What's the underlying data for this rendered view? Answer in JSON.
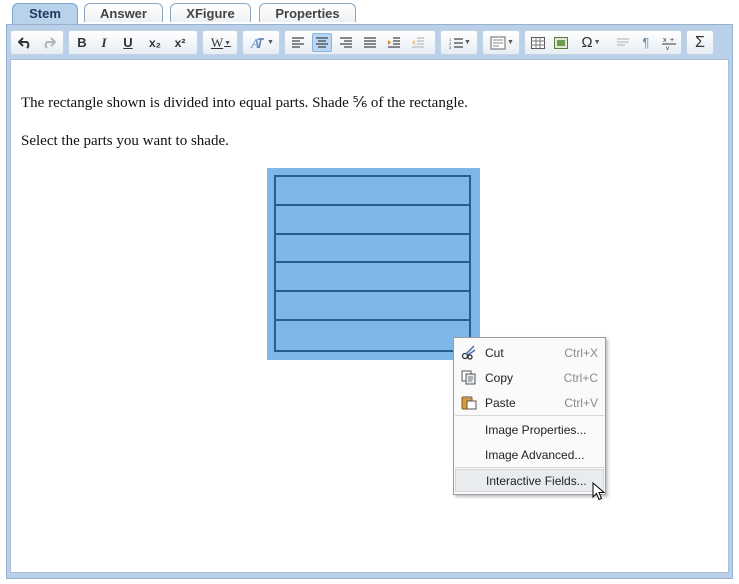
{
  "tabs": [
    {
      "label": "Stem",
      "active": true
    },
    {
      "label": "Answer",
      "active": false
    },
    {
      "label": "XFigure",
      "active": false
    },
    {
      "label": "Properties",
      "active": false
    }
  ],
  "toolbar": {
    "bold": "B",
    "italic": "I",
    "underline": "U",
    "subscript": "x₂",
    "superscript": "x²",
    "word_format": "W",
    "omega": "Ω",
    "sigma": "Σ",
    "pilcrow": "¶"
  },
  "content": {
    "line1": "The rectangle shown is divided into equal parts. Shade ⅚ of the rectangle.",
    "line2": "Select the parts you want to shade."
  },
  "figure": {
    "parts": 6,
    "fill_color": "#7fb7e9",
    "line_color": "#2a5d8f"
  },
  "context_menu": {
    "items": [
      {
        "label": "Cut",
        "shortcut": "Ctrl+X",
        "icon": "scissors-icon"
      },
      {
        "label": "Copy",
        "shortcut": "Ctrl+C",
        "icon": "copy-icon"
      },
      {
        "label": "Paste",
        "shortcut": "Ctrl+V",
        "icon": "paste-icon"
      },
      {
        "label": "Image Properties...",
        "shortcut": ""
      },
      {
        "label": "Image Advanced...",
        "shortcut": ""
      },
      {
        "label": "Interactive Fields...",
        "shortcut": "",
        "hovered": true
      }
    ]
  }
}
